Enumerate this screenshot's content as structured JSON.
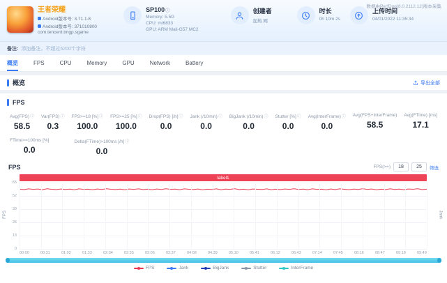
{
  "header": {
    "collector_note": "数据由PerfDog(8.0.2112.12)版本采集",
    "app": {
      "title": "王者荣耀",
      "version_line1": "Android版本号: 3.71.1.8",
      "version_line2": "Android版本号: 371010800",
      "package": "com.tencent.tmgp.sgame"
    },
    "device": {
      "name": "SP100",
      "memory": "Memory: 5.5G",
      "cpu": "CPU: mt6833",
      "gpu": "GPU: ARM Mali-G57 MC2"
    },
    "creator": {
      "label": "创建者",
      "value": "加热 网"
    },
    "duration": {
      "label": "时长",
      "value": "0h 10m 2s"
    },
    "upload_time": {
      "label": "上传时间",
      "value": "04/01/2022 11:35:34"
    }
  },
  "remark": {
    "label": "备注:",
    "placeholder": "添加备注，不超过5200个字符"
  },
  "tabs": {
    "active": "概览",
    "items": [
      "概览",
      "FPS",
      "CPU",
      "Memory",
      "GPU",
      "Network",
      "Battery"
    ]
  },
  "overview": {
    "title": "概览",
    "export_label": "导出全部"
  },
  "fps_card": {
    "title": "FPS",
    "metrics_row1": [
      {
        "label": "Avg(FPS)",
        "info": true,
        "value": "58.5"
      },
      {
        "label": "Var(FPS)",
        "info": true,
        "value": "0.3"
      },
      {
        "label": "FPS>=18 [%]",
        "info": true,
        "value": "100.0"
      },
      {
        "label": "FPS>=25 [%]",
        "info": true,
        "value": "100.0"
      },
      {
        "label": "Drop(FPS) [/h]",
        "info": true,
        "value": "0.0"
      },
      {
        "label": "Jank (/10min)",
        "info": true,
        "value": "0.0"
      },
      {
        "label": "BigJank (/10min)",
        "info": true,
        "value": "0.0"
      },
      {
        "label": "Stutter [%]",
        "info": true,
        "value": "0.0"
      },
      {
        "label": "Avg(InterFrame)",
        "info": true,
        "value": "0.0"
      },
      {
        "label": "Avg(FPS+InterFrame)",
        "info": false,
        "value": "58.5"
      },
      {
        "label": "Avg(FTime) [ms]",
        "info": false,
        "value": "17.1"
      }
    ],
    "metrics_row2": [
      {
        "label": "FTime>=100ms [%]",
        "info": false,
        "value": "0.0"
      },
      {
        "label": "Delta(FTime)>100ms [/h]",
        "info": true,
        "value": "0.0"
      }
    ]
  },
  "chart": {
    "title": "FPS",
    "filter": {
      "label": "FPS(>=)",
      "min": "18",
      "max": "25",
      "action": "筛选"
    }
  },
  "chart_data": {
    "type": "line",
    "title": "FPS",
    "annotation": "label1",
    "y_left": {
      "label": "FPS",
      "ticks": [
        65,
        52,
        39,
        26,
        13,
        0
      ],
      "range": [
        0,
        65
      ]
    },
    "y_right": {
      "label": "Jank",
      "range": [
        0,
        65
      ]
    },
    "x_ticks": [
      "00:00",
      "00:31",
      "01:02",
      "01:33",
      "02:04",
      "02:35",
      "03:06",
      "03:37",
      "04:08",
      "04:39",
      "05:10",
      "05:41",
      "06:12",
      "06:43",
      "07:14",
      "07:45",
      "08:16",
      "08:47",
      "09:18",
      "09:49"
    ],
    "series": [
      {
        "name": "FPS",
        "color": "#e8384f",
        "values": [
          58.6,
          58.2,
          58.9,
          58.4,
          58.8,
          58.1,
          59.0,
          58.5,
          58.2,
          58.8,
          58.3,
          58.7,
          58.0,
          58.9,
          58.4,
          58.6,
          58.1,
          58.8,
          58.3,
          59.0,
          58.5,
          58.2,
          58.7,
          58.0,
          58.8,
          58.4,
          58.9,
          58.2,
          58.6,
          58.1,
          58.8,
          58.3,
          59.0,
          58.4,
          58.7,
          58.1,
          58.9,
          58.5,
          58.2,
          58.8,
          58.0,
          58.6,
          58.3,
          58.9,
          58.1,
          58.7,
          58.4,
          59.0,
          58.2,
          58.6,
          58.0,
          58.8,
          58.5,
          58.3,
          58.9,
          58.1,
          58.6,
          58.2,
          58.8,
          58.4,
          59.0,
          58.3,
          58.7,
          58.1,
          58.9,
          58.4,
          58.6,
          58.0,
          58.8,
          58.2,
          58.9,
          58.5,
          58.1,
          58.7,
          58.3,
          59.0,
          58.4,
          58.8,
          58.0,
          58.6,
          58.2,
          58.9,
          58.3,
          58.7,
          58.1,
          58.8,
          58.5,
          59.0,
          58.2,
          58.6
        ]
      }
    ],
    "legend": [
      {
        "name": "FPS",
        "color": "#e8384f"
      },
      {
        "name": "Jank",
        "color": "#3a7bf4"
      },
      {
        "name": "BigJank",
        "color": "#1f3bb3"
      },
      {
        "name": "Stutter",
        "color": "#8a94a6"
      },
      {
        "name": "InterFrame",
        "color": "#2fc6c8"
      }
    ]
  }
}
